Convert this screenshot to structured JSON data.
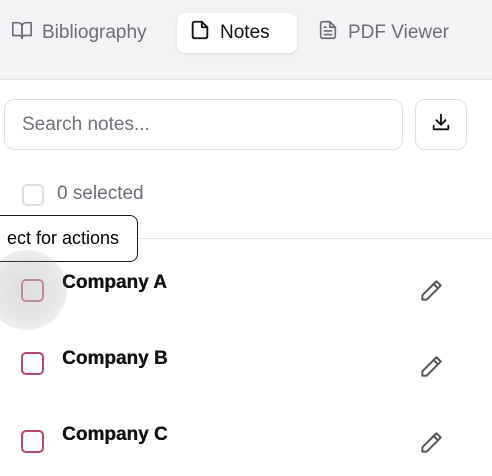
{
  "tabs": [
    {
      "label": "Bibliography",
      "icon": "book-icon",
      "active": false
    },
    {
      "label": "Notes",
      "icon": "note-icon",
      "active": true
    },
    {
      "label": "PDF Viewer",
      "icon": "document-icon",
      "active": false
    }
  ],
  "search": {
    "placeholder": "Search notes...",
    "value": ""
  },
  "toolbar": {
    "download_icon": "download-icon"
  },
  "selection": {
    "count_label": "0 selected"
  },
  "tooltip": {
    "text": "ect for actions"
  },
  "notes": [
    {
      "title": "Company A"
    },
    {
      "title": "Company B"
    },
    {
      "title": "Company C"
    }
  ],
  "colors": {
    "accent": "#b8476c",
    "tab_bar_bg": "#f3f2f5",
    "text_muted": "#6b6f76"
  }
}
